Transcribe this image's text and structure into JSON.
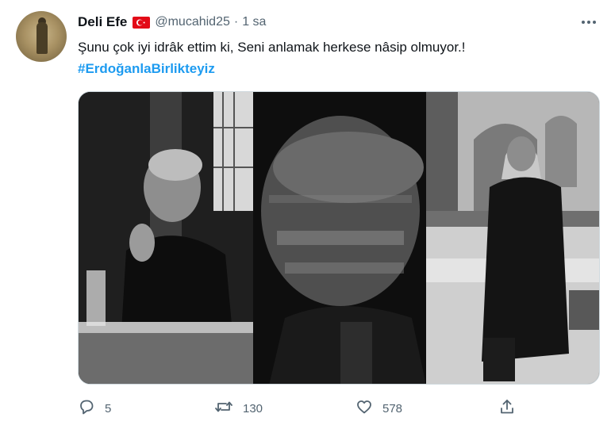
{
  "user": {
    "name": "Deli Efe",
    "handle": "@mucahid25",
    "separator": "·",
    "time": "1 sa",
    "flag_color": "#e30a17"
  },
  "tweet": {
    "text": "Şunu çok iyi idrâk ettim ki, Seni anlamak herkese nâsip olmuyor.!",
    "hashtag": "#ErdoğanlaBirlikteyiz",
    "hashtag_color": "#1d9bf0"
  },
  "media": {
    "photo_count": 3
  },
  "actions": {
    "reply_count": "5",
    "retweet_count": "130",
    "like_count": "578"
  },
  "icons": [
    "more-icon",
    "reply-icon",
    "retweet-icon",
    "like-icon",
    "share-icon",
    "flag-icon"
  ]
}
